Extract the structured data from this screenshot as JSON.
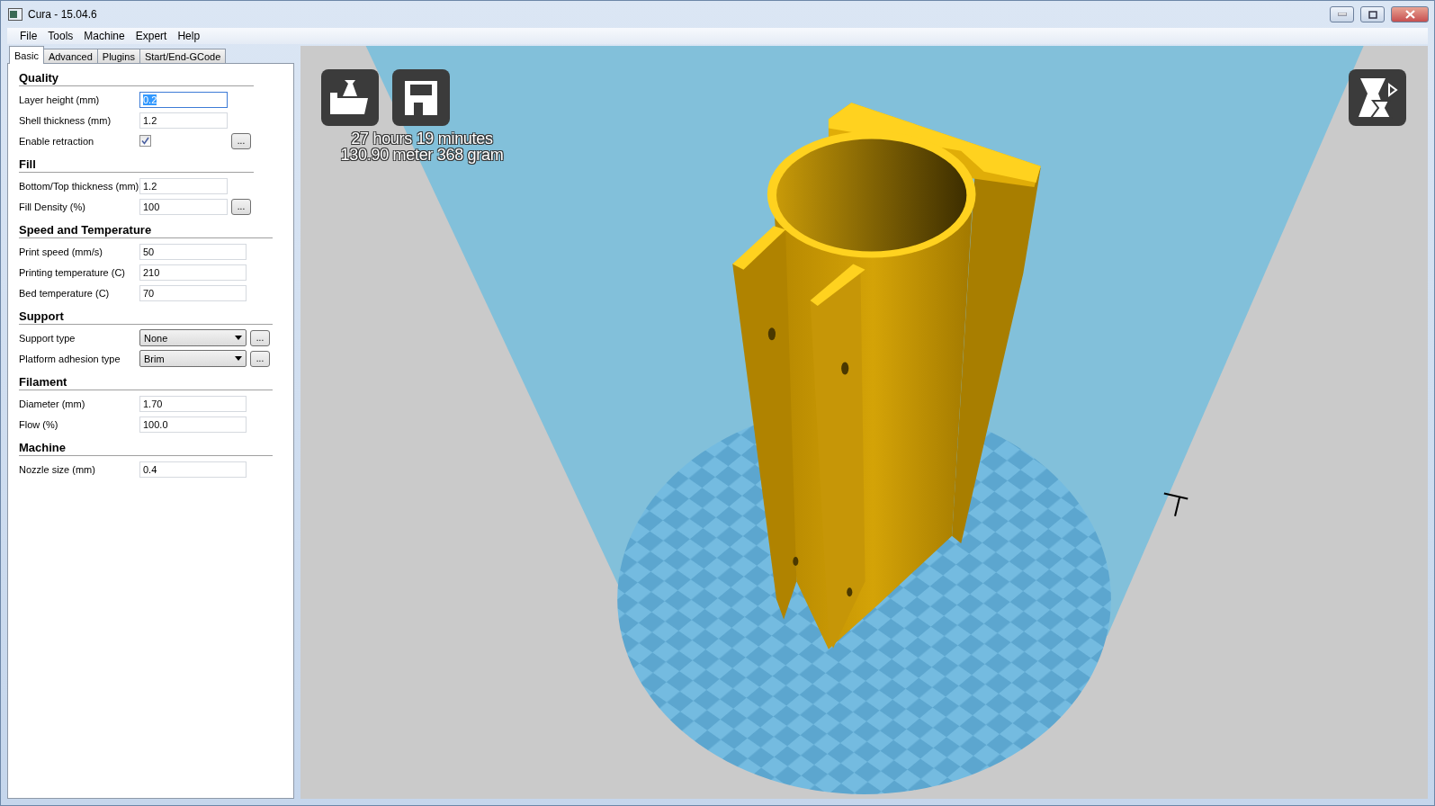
{
  "window": {
    "title": "Cura - 15.04.6"
  },
  "menu": [
    {
      "label": "File"
    },
    {
      "label": "Tools"
    },
    {
      "label": "Machine"
    },
    {
      "label": "Expert"
    },
    {
      "label": "Help"
    }
  ],
  "tabs": [
    {
      "label": "Basic",
      "selected": true
    },
    {
      "label": "Advanced",
      "selected": false
    },
    {
      "label": "Plugins",
      "selected": false
    },
    {
      "label": "Start/End-GCode",
      "selected": false
    }
  ],
  "settings": [
    {
      "title": "Quality",
      "rows": [
        {
          "kind": "text",
          "label": "Layer height (mm)",
          "value": "0.2",
          "focused": true
        },
        {
          "kind": "text",
          "label": "Shell thickness (mm)",
          "value": "1.2",
          "focused": false
        },
        {
          "kind": "checkbox",
          "label": "Enable retraction",
          "checked": true,
          "more": "..."
        }
      ]
    },
    {
      "title": "Fill",
      "rows": [
        {
          "kind": "text",
          "label": "Bottom/Top thickness (mm)",
          "value": "1.2",
          "focused": false
        },
        {
          "kind": "text",
          "label": "Fill Density (%)",
          "value": "100",
          "focused": false,
          "more": "..."
        }
      ]
    },
    {
      "title": "Speed and Temperature",
      "rows": [
        {
          "kind": "text",
          "label": "Print speed (mm/s)",
          "value": "50",
          "focused": false
        },
        {
          "kind": "text",
          "label": "Printing temperature (C)",
          "value": "210",
          "focused": false
        },
        {
          "kind": "text",
          "label": "Bed temperature (C)",
          "value": "70",
          "focused": false
        }
      ]
    },
    {
      "title": "Support",
      "rows": [
        {
          "kind": "select",
          "label": "Support type",
          "value": "None",
          "more": "..."
        },
        {
          "kind": "select",
          "label": "Platform adhesion type",
          "value": "Brim",
          "more": "..."
        }
      ]
    },
    {
      "title": "Filament",
      "rows": [
        {
          "kind": "text",
          "label": "Diameter (mm)",
          "value": "1.70",
          "focused": false
        },
        {
          "kind": "text",
          "label": "Flow (%)",
          "value": "100.0",
          "focused": false
        }
      ]
    },
    {
      "title": "Machine",
      "rows": [
        {
          "kind": "text",
          "label": "Nozzle size (mm)",
          "value": "0.4",
          "focused": false
        }
      ]
    }
  ],
  "viewport": {
    "stats": [
      "27 hours 19 minutes",
      "130.90 meter 368 gram"
    ]
  }
}
